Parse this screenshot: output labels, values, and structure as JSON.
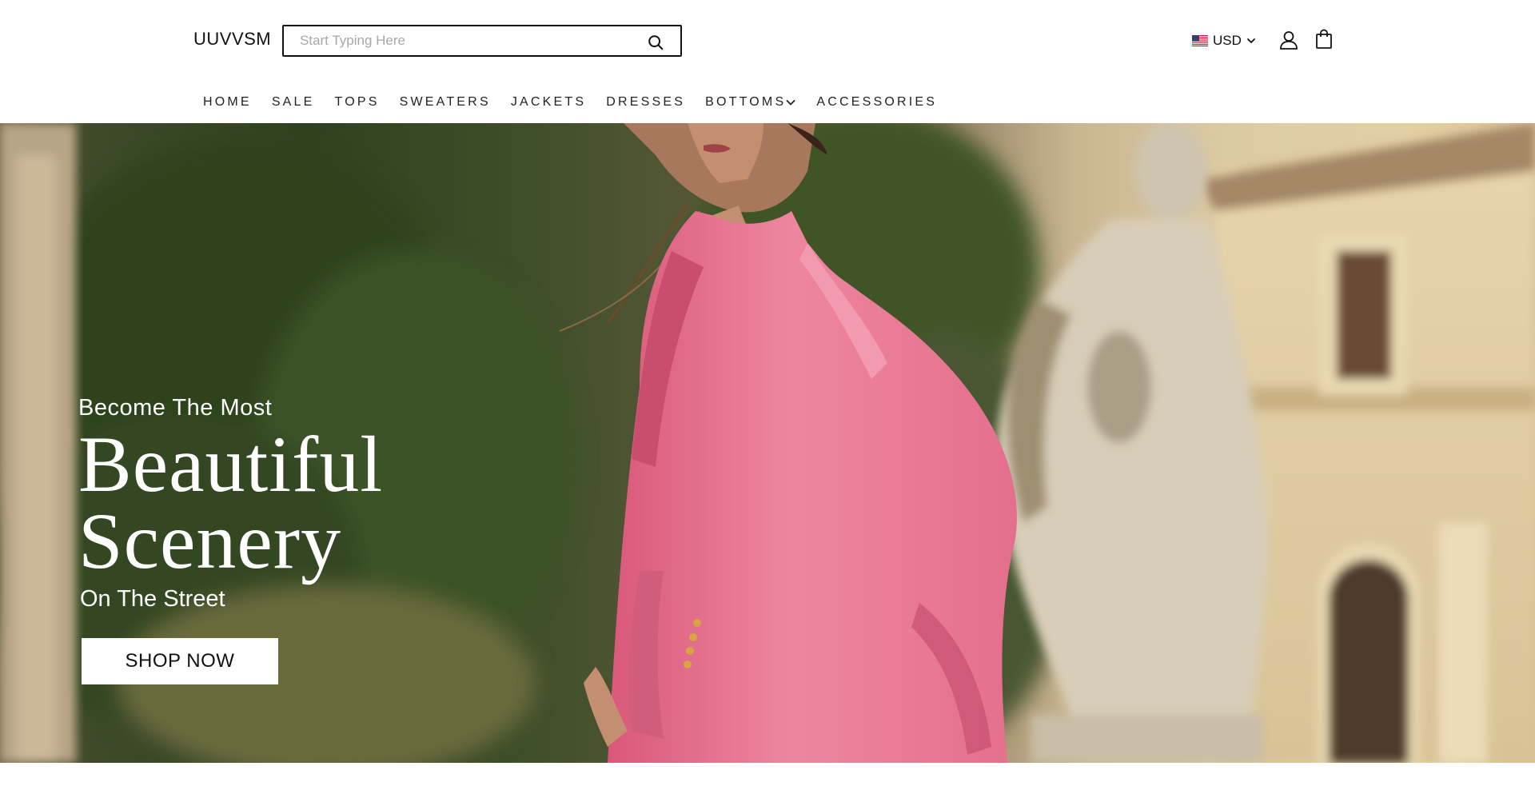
{
  "header": {
    "logo": "UUVVSM",
    "search": {
      "placeholder": "Start Typing Here",
      "value": ""
    },
    "currency": {
      "label": "USD",
      "flag": "us-flag-icon"
    },
    "icons": {
      "search": "search-icon",
      "account": "user-icon",
      "cart": "shopping-bag-icon"
    }
  },
  "nav": {
    "items": [
      {
        "label": "HOME"
      },
      {
        "label": "SALE"
      },
      {
        "label": "TOPS"
      },
      {
        "label": "SWEATERS"
      },
      {
        "label": "JACKETS"
      },
      {
        "label": "DRESSES"
      },
      {
        "label": "BOTTOMS",
        "has_dropdown": true
      },
      {
        "label": "ACCESSORIES"
      }
    ]
  },
  "hero": {
    "eyebrow": "Become The Most",
    "headline_line1": "Beautiful",
    "headline_line2": "Scenery",
    "subline": "On The Street",
    "cta_label": "SHOP NOW"
  },
  "colors": {
    "text": "#111111",
    "background": "#ffffff",
    "jacket_pink": "#e9738f",
    "hero_text": "#ffffff"
  }
}
